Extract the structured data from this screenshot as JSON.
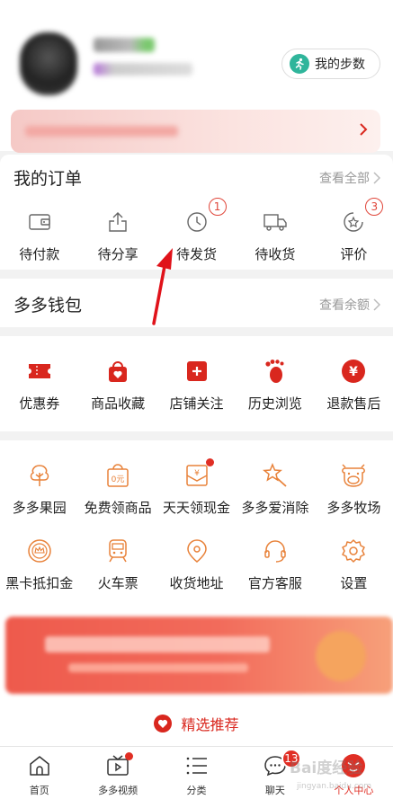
{
  "profile": {
    "steps_label": "我的步数"
  },
  "orders": {
    "title": "我的订单",
    "view_all": "查看全部",
    "items": [
      {
        "label": "待付款",
        "icon": "wallet-icon",
        "badge": ""
      },
      {
        "label": "待分享",
        "icon": "share-icon",
        "badge": ""
      },
      {
        "label": "待发货",
        "icon": "clock-icon",
        "badge": "1"
      },
      {
        "label": "待收货",
        "icon": "truck-icon",
        "badge": ""
      },
      {
        "label": "评价",
        "icon": "star-icon",
        "badge": "3"
      }
    ]
  },
  "wallet": {
    "title": "多多钱包",
    "view_balance": "查看余额"
  },
  "quick": {
    "items": [
      {
        "label": "优惠券",
        "icon": "coupon-icon"
      },
      {
        "label": "商品收藏",
        "icon": "favorite-bag-icon"
      },
      {
        "label": "店铺关注",
        "icon": "store-follow-icon"
      },
      {
        "label": "历史浏览",
        "icon": "footprint-icon"
      },
      {
        "label": "退款售后",
        "icon": "refund-icon"
      }
    ]
  },
  "services": {
    "row1": [
      {
        "label": "多多果园",
        "icon": "tree-icon",
        "dot": false
      },
      {
        "label": "免费领商品",
        "icon": "free-goods-icon",
        "dot": false
      },
      {
        "label": "天天领现金",
        "icon": "cash-envelope-icon",
        "dot": true
      },
      {
        "label": "多多爱消除",
        "icon": "star-wand-icon",
        "dot": false
      },
      {
        "label": "多多牧场",
        "icon": "cow-icon",
        "dot": false
      }
    ],
    "row2": [
      {
        "label": "黑卡抵扣金",
        "icon": "black-card-icon"
      },
      {
        "label": "火车票",
        "icon": "train-icon"
      },
      {
        "label": "收货地址",
        "icon": "location-icon"
      },
      {
        "label": "官方客服",
        "icon": "headset-icon"
      },
      {
        "label": "设置",
        "icon": "settings-icon"
      }
    ]
  },
  "recommend": {
    "label": "精选推荐"
  },
  "tabbar": {
    "items": [
      {
        "label": "首页",
        "icon": "home-icon"
      },
      {
        "label": "多多视频",
        "icon": "video-icon",
        "dot": true
      },
      {
        "label": "分类",
        "icon": "category-icon"
      },
      {
        "label": "聊天",
        "icon": "chat-icon",
        "badge": "13"
      },
      {
        "label": "个人中心",
        "icon": "profile-icon",
        "active": true
      }
    ]
  },
  "colors": {
    "brand_red": "#e02e24",
    "icon_orange": "#e8823a",
    "steps_green": "#2fb59b"
  },
  "watermark": {
    "text": "Bai度经验",
    "sub": "jingyan.baidu.com"
  }
}
